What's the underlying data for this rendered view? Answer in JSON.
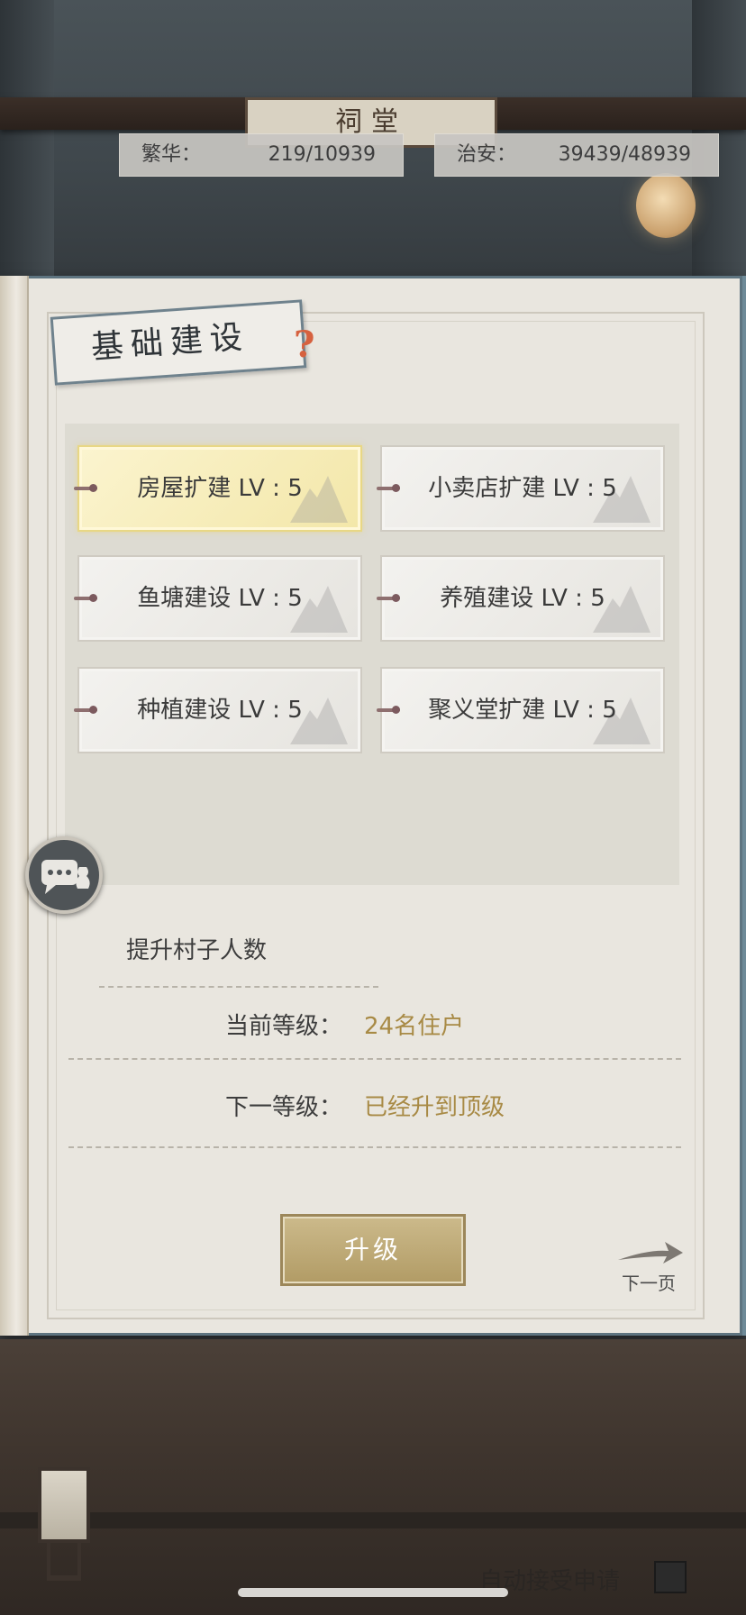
{
  "header": {
    "plaque_text": "祠堂",
    "prosperity": {
      "label": "繁华：",
      "value": "219/10939"
    },
    "security": {
      "label": "治安：",
      "value": "39439/48939"
    }
  },
  "panel": {
    "title": "基础建设",
    "help_icon": "question-mark-icon",
    "buildings": [
      {
        "label": "房屋扩建 LV : 5",
        "selected": true
      },
      {
        "label": "小卖店扩建 LV : 5",
        "selected": false
      },
      {
        "label": "鱼塘建设 LV : 5",
        "selected": false
      },
      {
        "label": "养殖建设 LV : 5",
        "selected": false
      },
      {
        "label": "种植建设 LV : 5",
        "selected": false
      },
      {
        "label": "聚义堂扩建 LV : 5",
        "selected": false
      }
    ],
    "detail": {
      "title": "提升村子人数",
      "current_label": "当前等级：",
      "current_value": "24名住户",
      "next_label": "下一等级：",
      "next_value": "已经升到顶级"
    },
    "upgrade_button": "升级",
    "next_page": "下一页"
  },
  "footer": {
    "auto_accept_label": "自动接受申请",
    "auto_accept_checked": true
  },
  "colors": {
    "accent_gold": "#a88a45",
    "selected_card": "#f6ecbb",
    "help_icon": "#d6613f"
  }
}
